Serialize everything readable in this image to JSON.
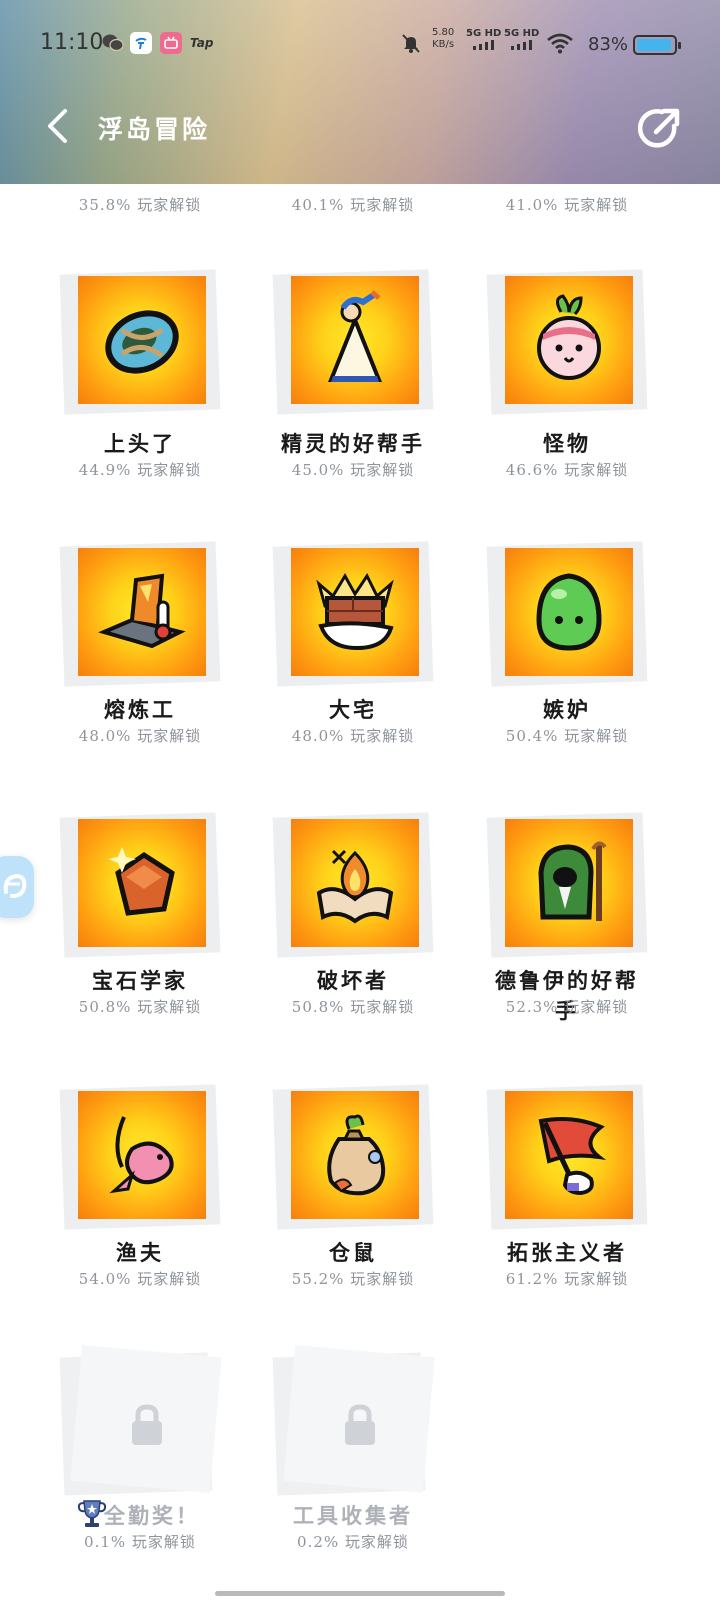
{
  "status_bar": {
    "time": "11:10",
    "net_speed_value": "5.80",
    "net_speed_unit": "KB/s",
    "sim1_label": "5G HD",
    "sim2_label": "5G HD",
    "battery_percent": "83%",
    "app_icons": [
      "wechat-icon",
      "china-telecom-icon",
      "bilibili-icon",
      "taptap-icon"
    ],
    "tap_label": "Tap"
  },
  "nav": {
    "title": "浮岛冒险"
  },
  "top_partial_row": [
    {
      "percent": "35.8% 玩家解锁"
    },
    {
      "percent": "40.1% 玩家解锁"
    },
    {
      "percent": "41.0% 玩家解锁"
    }
  ],
  "achievements": [
    {
      "name": "上头了",
      "percent": "44.9% 玩家解锁",
      "icon": "dizzy-mask-icon",
      "locked": false
    },
    {
      "name": "精灵的好帮手",
      "percent": "45.0% 玩家解锁",
      "icon": "fairy-princess-icon",
      "locked": false
    },
    {
      "name": "怪物",
      "percent": "46.6% 玩家解锁",
      "icon": "radish-monster-icon",
      "locked": false
    },
    {
      "name": "熔炼工",
      "percent": "48.0% 玩家解锁",
      "icon": "furnace-thermometer-icon",
      "locked": false
    },
    {
      "name": "大宅",
      "percent": "48.0% 玩家解锁",
      "icon": "brick-hand-icon",
      "locked": false
    },
    {
      "name": "嫉妒",
      "percent": "50.4% 玩家解锁",
      "icon": "green-slime-icon",
      "locked": false
    },
    {
      "name": "宝石学家",
      "percent": "50.8% 玩家解锁",
      "icon": "gem-icon",
      "locked": false
    },
    {
      "name": "破坏者",
      "percent": "50.8% 玩家解锁",
      "icon": "burning-book-icon",
      "locked": false
    },
    {
      "name": "德鲁伊的好帮手",
      "percent": "52.3% 玩家解锁",
      "icon": "druid-icon",
      "locked": false
    },
    {
      "name": "渔夫",
      "percent": "54.0% 玩家解锁",
      "icon": "fish-hook-icon",
      "locked": false
    },
    {
      "name": "仓鼠",
      "percent": "55.2% 玩家解锁",
      "icon": "loot-sack-icon",
      "locked": false
    },
    {
      "name": "拓张主义者",
      "percent": "61.2% 玩家解锁",
      "icon": "flag-hand-icon",
      "locked": false
    },
    {
      "name": "全勤奖！",
      "percent": "0.1% 玩家解锁",
      "icon": "lock-icon",
      "locked": true,
      "badge_icon": "trophy-icon"
    },
    {
      "name": "工具收集者",
      "percent": "0.2% 玩家解锁",
      "icon": "lock-icon",
      "locked": true
    }
  ],
  "colors": {
    "card_art_center": "#ffe92a",
    "card_art_edge": "#f47f0e",
    "locked_text": "#aeb2b8",
    "percent_text": "#8e949a"
  }
}
